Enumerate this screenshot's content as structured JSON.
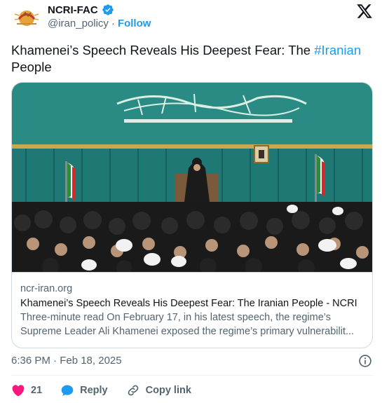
{
  "author": {
    "name": "NCRI-FAC",
    "handle": "@iran_policy",
    "separator": "·",
    "follow_label": "Follow"
  },
  "tweet": {
    "text_before": "Khamenei’s Speech Reveals His Deepest Fear: The ",
    "hashtag": "#Iranian",
    "text_after": " People"
  },
  "card": {
    "domain": "ncr-iran.org",
    "title": "Khamenei’s Speech Reveals His Deepest Fear: The Iranian People  - NCRI",
    "description_line1": "Three-minute read On February 17, in his latest speech, the regime’s",
    "description_line2": "Supreme Leader Ali Khamenei exposed the regime’s primary vulnerabilit..."
  },
  "meta": {
    "timestamp": "6:36 PM · Feb 18, 2025"
  },
  "actions": {
    "likes_count": "21",
    "reply_label": "Reply",
    "copy_link_label": "Copy link"
  },
  "colors": {
    "accent": "#1d9bf0",
    "like": "#f91880",
    "secondary_text": "#536471",
    "border": "#cfd9de"
  }
}
